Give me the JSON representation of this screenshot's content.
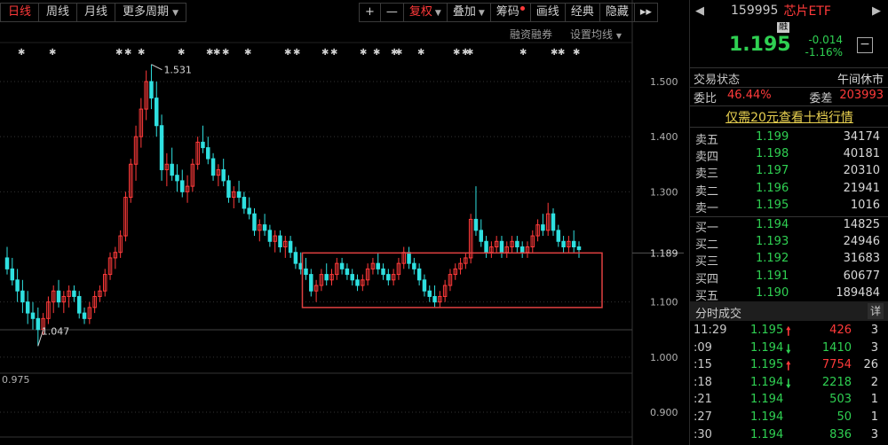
{
  "toolbar": {
    "period_tabs": [
      "日线",
      "周线",
      "月线",
      "更多周期"
    ],
    "active_tab": 0,
    "buttons": [
      "+",
      "—",
      "复权",
      "叠加",
      "筹码",
      "画线",
      "经典",
      "隐藏",
      "▸▸"
    ],
    "sub_links": [
      "融资融券",
      "设置均线"
    ]
  },
  "chart_data": {
    "type": "candlestick",
    "y_axis_ticks": [
      "1.500",
      "1.400",
      "1.300",
      "1.100",
      "1.000",
      "0.975",
      "0.900"
    ],
    "y_range": [
      0.88,
      1.6
    ],
    "current_price_label": "1.189",
    "current_price": 1.189,
    "high_label": "1.531",
    "high_value": 1.531,
    "low_label": "1.047",
    "low_value": 1.047,
    "consolidation_box": {
      "price_top": 1.189,
      "price_bottom": 1.09,
      "start_index": 58,
      "end_index": 112
    },
    "colors": {
      "up": "#ff3a3a",
      "down": "#2fe0e0",
      "box": "#e04040",
      "grid": "#333333"
    },
    "candles": [
      [
        1.18,
        1.2,
        1.15,
        1.16
      ],
      [
        1.16,
        1.18,
        1.13,
        1.14
      ],
      [
        1.14,
        1.16,
        1.1,
        1.12
      ],
      [
        1.12,
        1.14,
        1.08,
        1.1
      ],
      [
        1.1,
        1.12,
        1.06,
        1.08
      ],
      [
        1.08,
        1.1,
        1.05,
        1.07
      ],
      [
        1.07,
        1.09,
        1.02,
        1.05
      ],
      [
        1.05,
        1.08,
        1.04,
        1.07
      ],
      [
        1.07,
        1.11,
        1.06,
        1.1
      ],
      [
        1.1,
        1.13,
        1.08,
        1.12
      ],
      [
        1.12,
        1.14,
        1.09,
        1.1
      ],
      [
        1.1,
        1.12,
        1.08,
        1.11
      ],
      [
        1.11,
        1.13,
        1.09,
        1.12
      ],
      [
        1.12,
        1.13,
        1.1,
        1.11
      ],
      [
        1.11,
        1.12,
        1.07,
        1.08
      ],
      [
        1.08,
        1.09,
        1.06,
        1.07
      ],
      [
        1.07,
        1.1,
        1.06,
        1.09
      ],
      [
        1.09,
        1.12,
        1.08,
        1.11
      ],
      [
        1.11,
        1.13,
        1.1,
        1.12
      ],
      [
        1.12,
        1.16,
        1.11,
        1.15
      ],
      [
        1.15,
        1.19,
        1.14,
        1.18
      ],
      [
        1.18,
        1.2,
        1.16,
        1.19
      ],
      [
        1.19,
        1.23,
        1.18,
        1.22
      ],
      [
        1.22,
        1.3,
        1.21,
        1.29
      ],
      [
        1.29,
        1.36,
        1.28,
        1.35
      ],
      [
        1.35,
        1.42,
        1.32,
        1.4
      ],
      [
        1.4,
        1.47,
        1.38,
        1.45
      ],
      [
        1.45,
        1.52,
        1.43,
        1.5
      ],
      [
        1.5,
        1.531,
        1.45,
        1.47
      ],
      [
        1.47,
        1.5,
        1.4,
        1.42
      ],
      [
        1.42,
        1.44,
        1.32,
        1.34
      ],
      [
        1.34,
        1.37,
        1.31,
        1.35
      ],
      [
        1.35,
        1.38,
        1.32,
        1.33
      ],
      [
        1.33,
        1.35,
        1.3,
        1.32
      ],
      [
        1.32,
        1.34,
        1.29,
        1.3
      ],
      [
        1.3,
        1.33,
        1.28,
        1.31
      ],
      [
        1.31,
        1.36,
        1.3,
        1.35
      ],
      [
        1.35,
        1.4,
        1.34,
        1.39
      ],
      [
        1.39,
        1.42,
        1.37,
        1.38
      ],
      [
        1.38,
        1.4,
        1.35,
        1.36
      ],
      [
        1.36,
        1.37,
        1.32,
        1.33
      ],
      [
        1.33,
        1.35,
        1.31,
        1.34
      ],
      [
        1.34,
        1.36,
        1.31,
        1.32
      ],
      [
        1.32,
        1.33,
        1.28,
        1.29
      ],
      [
        1.29,
        1.31,
        1.27,
        1.3
      ],
      [
        1.3,
        1.32,
        1.28,
        1.29
      ],
      [
        1.29,
        1.3,
        1.26,
        1.27
      ],
      [
        1.27,
        1.29,
        1.25,
        1.26
      ],
      [
        1.26,
        1.27,
        1.22,
        1.23
      ],
      [
        1.23,
        1.25,
        1.21,
        1.24
      ],
      [
        1.24,
        1.26,
        1.22,
        1.23
      ],
      [
        1.23,
        1.24,
        1.2,
        1.21
      ],
      [
        1.21,
        1.23,
        1.19,
        1.22
      ],
      [
        1.22,
        1.23,
        1.19,
        1.2
      ],
      [
        1.2,
        1.22,
        1.18,
        1.21
      ],
      [
        1.21,
        1.22,
        1.18,
        1.19
      ],
      [
        1.19,
        1.2,
        1.16,
        1.17
      ],
      [
        1.17,
        1.19,
        1.15,
        1.16
      ],
      [
        1.16,
        1.18,
        1.14,
        1.15
      ],
      [
        1.15,
        1.16,
        1.11,
        1.12
      ],
      [
        1.12,
        1.14,
        1.1,
        1.13
      ],
      [
        1.13,
        1.16,
        1.12,
        1.15
      ],
      [
        1.15,
        1.17,
        1.13,
        1.14
      ],
      [
        1.14,
        1.16,
        1.13,
        1.15
      ],
      [
        1.15,
        1.18,
        1.14,
        1.17
      ],
      [
        1.17,
        1.18,
        1.15,
        1.16
      ],
      [
        1.16,
        1.17,
        1.14,
        1.15
      ],
      [
        1.15,
        1.16,
        1.13,
        1.14
      ],
      [
        1.14,
        1.15,
        1.12,
        1.13
      ],
      [
        1.13,
        1.15,
        1.12,
        1.14
      ],
      [
        1.14,
        1.17,
        1.13,
        1.16
      ],
      [
        1.16,
        1.18,
        1.15,
        1.17
      ],
      [
        1.17,
        1.19,
        1.15,
        1.16
      ],
      [
        1.16,
        1.17,
        1.14,
        1.15
      ],
      [
        1.15,
        1.16,
        1.13,
        1.14
      ],
      [
        1.14,
        1.16,
        1.13,
        1.15
      ],
      [
        1.15,
        1.18,
        1.14,
        1.17
      ],
      [
        1.17,
        1.2,
        1.16,
        1.19
      ],
      [
        1.19,
        1.2,
        1.16,
        1.17
      ],
      [
        1.17,
        1.18,
        1.15,
        1.16
      ],
      [
        1.16,
        1.17,
        1.13,
        1.14
      ],
      [
        1.14,
        1.15,
        1.11,
        1.12
      ],
      [
        1.12,
        1.13,
        1.1,
        1.11
      ],
      [
        1.11,
        1.13,
        1.09,
        1.1
      ],
      [
        1.1,
        1.12,
        1.09,
        1.11
      ],
      [
        1.11,
        1.14,
        1.1,
        1.13
      ],
      [
        1.13,
        1.16,
        1.12,
        1.15
      ],
      [
        1.15,
        1.17,
        1.14,
        1.16
      ],
      [
        1.16,
        1.18,
        1.15,
        1.17
      ],
      [
        1.17,
        1.19,
        1.16,
        1.18
      ],
      [
        1.18,
        1.26,
        1.17,
        1.25
      ],
      [
        1.25,
        1.31,
        1.22,
        1.23
      ],
      [
        1.23,
        1.25,
        1.2,
        1.21
      ],
      [
        1.21,
        1.22,
        1.18,
        1.19
      ],
      [
        1.19,
        1.21,
        1.18,
        1.2
      ],
      [
        1.2,
        1.22,
        1.19,
        1.21
      ],
      [
        1.21,
        1.22,
        1.18,
        1.19
      ],
      [
        1.19,
        1.21,
        1.18,
        1.2
      ],
      [
        1.2,
        1.22,
        1.19,
        1.21
      ],
      [
        1.21,
        1.22,
        1.19,
        1.2
      ],
      [
        1.2,
        1.21,
        1.18,
        1.19
      ],
      [
        1.19,
        1.21,
        1.18,
        1.2
      ],
      [
        1.2,
        1.23,
        1.19,
        1.22
      ],
      [
        1.22,
        1.25,
        1.21,
        1.24
      ],
      [
        1.24,
        1.26,
        1.22,
        1.23
      ],
      [
        1.23,
        1.28,
        1.22,
        1.26
      ],
      [
        1.26,
        1.27,
        1.22,
        1.23
      ],
      [
        1.23,
        1.24,
        1.2,
        1.21
      ],
      [
        1.21,
        1.22,
        1.19,
        1.2
      ],
      [
        1.2,
        1.22,
        1.19,
        1.21
      ],
      [
        1.21,
        1.23,
        1.19,
        1.2
      ],
      [
        1.2,
        1.21,
        1.18,
        1.195
      ]
    ]
  },
  "quote": {
    "code": "159995",
    "name": "芯片ETF",
    "badge": "融",
    "price": "1.195",
    "change": "-0.014",
    "change_pct": "-1.16%",
    "status_label": "交易状态",
    "status_value": "午间休市",
    "webi_label": "委比",
    "webi_value": "46.44%",
    "weicha_label": "委差",
    "weicha_value": "203993",
    "promo": "仅需20元查看十档行情"
  },
  "orderbook": {
    "asks": [
      {
        "label": "卖五",
        "price": "1.199",
        "vol": "34174"
      },
      {
        "label": "卖四",
        "price": "1.198",
        "vol": "40181"
      },
      {
        "label": "卖三",
        "price": "1.197",
        "vol": "20310"
      },
      {
        "label": "卖二",
        "price": "1.196",
        "vol": "21941"
      },
      {
        "label": "卖一",
        "price": "1.195",
        "vol": "1016"
      }
    ],
    "bids": [
      {
        "label": "买一",
        "price": "1.194",
        "vol": "14825"
      },
      {
        "label": "买二",
        "price": "1.193",
        "vol": "24946"
      },
      {
        "label": "买三",
        "price": "1.192",
        "vol": "31683"
      },
      {
        "label": "买四",
        "price": "1.191",
        "vol": "60677"
      },
      {
        "label": "买五",
        "price": "1.190",
        "vol": "189484"
      }
    ]
  },
  "ticks": {
    "title": "分时成交",
    "detail_label": "详",
    "rows": [
      {
        "time": "11:29",
        "price": "1.195",
        "dir": "up",
        "vol": "426",
        "count": "3"
      },
      {
        "time": ":09",
        "price": "1.194",
        "dir": "down",
        "vol": "1410",
        "count": "3"
      },
      {
        "time": ":15",
        "price": "1.195",
        "dir": "up",
        "vol": "7754",
        "count": "26"
      },
      {
        "time": ":18",
        "price": "1.194",
        "dir": "down",
        "vol": "2218",
        "count": "2"
      },
      {
        "time": ":21",
        "price": "1.194",
        "dir": "none",
        "vol": "503",
        "count": "1"
      },
      {
        "time": ":27",
        "price": "1.194",
        "dir": "none",
        "vol": "50",
        "count": "1"
      },
      {
        "time": ":30",
        "price": "1.194",
        "dir": "none",
        "vol": "836",
        "count": "3"
      }
    ]
  }
}
